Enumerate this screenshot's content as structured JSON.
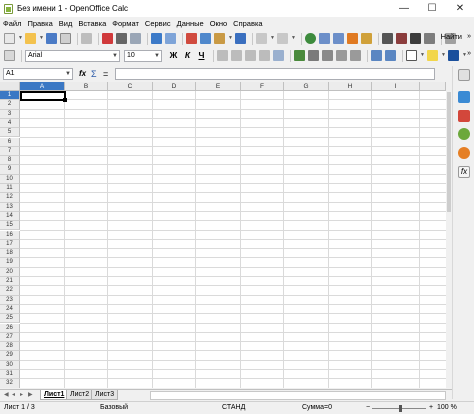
{
  "window": {
    "title": "Без имени 1 - OpenOffice Calc",
    "minimize": "—",
    "maximize": "☐",
    "close": "✕"
  },
  "menu": [
    "Файл",
    "Правка",
    "Вид",
    "Вставка",
    "Формат",
    "Сервис",
    "Данные",
    "Окно",
    "Справка"
  ],
  "toolbar": {
    "find_label": "Найти",
    "font_name": "Arial",
    "font_size": "10",
    "bold": "Ж",
    "italic": "К",
    "underline": "Ч",
    "overflow": "»"
  },
  "formula": {
    "name_box": "A1",
    "func_icon": "fx",
    "sum_icon": "Σ",
    "equals_icon": "=",
    "content": ""
  },
  "grid": {
    "columns": [
      "A",
      "B",
      "C",
      "D",
      "E",
      "F",
      "G",
      "H",
      "I"
    ],
    "rows": [
      "1",
      "2",
      "3",
      "4",
      "5",
      "6",
      "7",
      "8",
      "9",
      "10",
      "11",
      "12",
      "13",
      "14",
      "15",
      "16",
      "17",
      "18",
      "19",
      "20",
      "21",
      "22",
      "23",
      "24",
      "25",
      "26",
      "27",
      "28",
      "29",
      "30",
      "31",
      "32"
    ],
    "selected_cell": "A1"
  },
  "sheets": [
    "Лист1",
    "Лист2",
    "Лист3"
  ],
  "status": {
    "sheet": "Лист 1 / 3",
    "style": "Базовый",
    "mode": "СТАНД",
    "sum": "Сумма=0",
    "zoom": "100 %"
  },
  "colors": {
    "selected_header": "#3b78c4",
    "grid_line": "#dadada",
    "app_green": "#86b33c"
  }
}
